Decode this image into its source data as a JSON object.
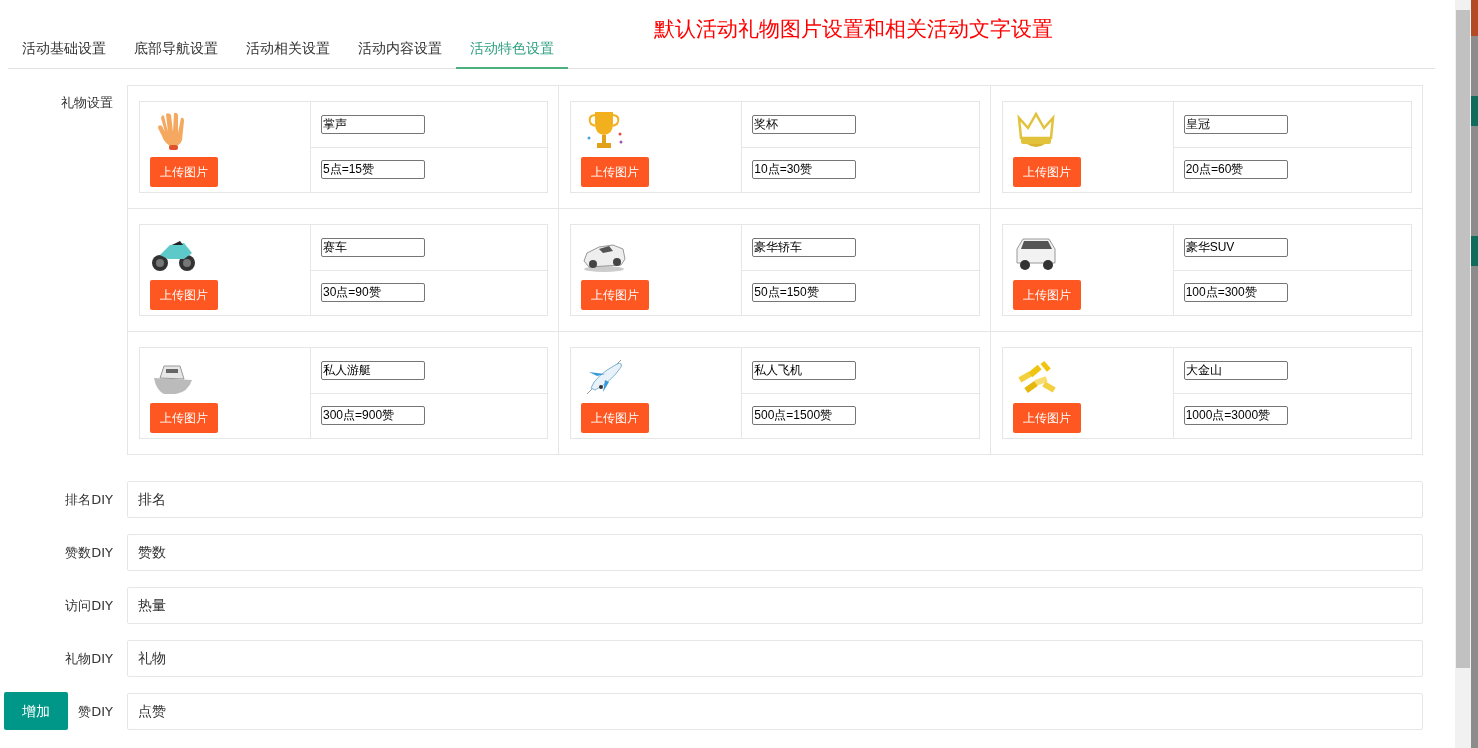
{
  "tabs": [
    {
      "label": "活动基础设置",
      "selected": false
    },
    {
      "label": "底部导航设置",
      "selected": false
    },
    {
      "label": "活动相关设置",
      "selected": false
    },
    {
      "label": "活动内容设置",
      "selected": false
    },
    {
      "label": "活动特色设置",
      "selected": true
    }
  ],
  "annotation": "默认活动礼物图片设置和相关活动文字设置",
  "gift_settings": {
    "label": "礼物设置",
    "gifts": [
      {
        "kind": "hand",
        "upload_button": "上传图片",
        "name": "掌声",
        "price": "5点=15赞"
      },
      {
        "kind": "trophy",
        "upload_button": "上传图片",
        "name": "奖杯",
        "price": "10点=30赞"
      },
      {
        "kind": "crown",
        "upload_button": "上传图片",
        "name": "皇冠",
        "price": "20点=60赞"
      },
      {
        "kind": "motorcycle",
        "upload_button": "上传图片",
        "name": "赛车",
        "price": "30点=90赞"
      },
      {
        "kind": "car",
        "upload_button": "上传图片",
        "name": "豪华轿车",
        "price": "50点=150赞"
      },
      {
        "kind": "suv",
        "upload_button": "上传图片",
        "name": "豪华SUV",
        "price": "100点=300赞"
      },
      {
        "kind": "yacht",
        "upload_button": "上传图片",
        "name": "私人游艇",
        "price": "300点=900赞"
      },
      {
        "kind": "airplane",
        "upload_button": "上传图片",
        "name": "私人飞机",
        "price": "500点=1500赞"
      },
      {
        "kind": "gold",
        "upload_button": "上传图片",
        "name": "大金山",
        "price": "1000点=3000赞"
      }
    ]
  },
  "diy_fields": [
    {
      "label": "排名DIY",
      "value": "排名"
    },
    {
      "label": "赞数DIY",
      "value": "赞数"
    },
    {
      "label": "访问DIY",
      "value": "热量"
    },
    {
      "label": "礼物DIY",
      "value": "礼物"
    },
    {
      "label": "赞DIY",
      "value": "点赞"
    }
  ],
  "add_button": "增加"
}
